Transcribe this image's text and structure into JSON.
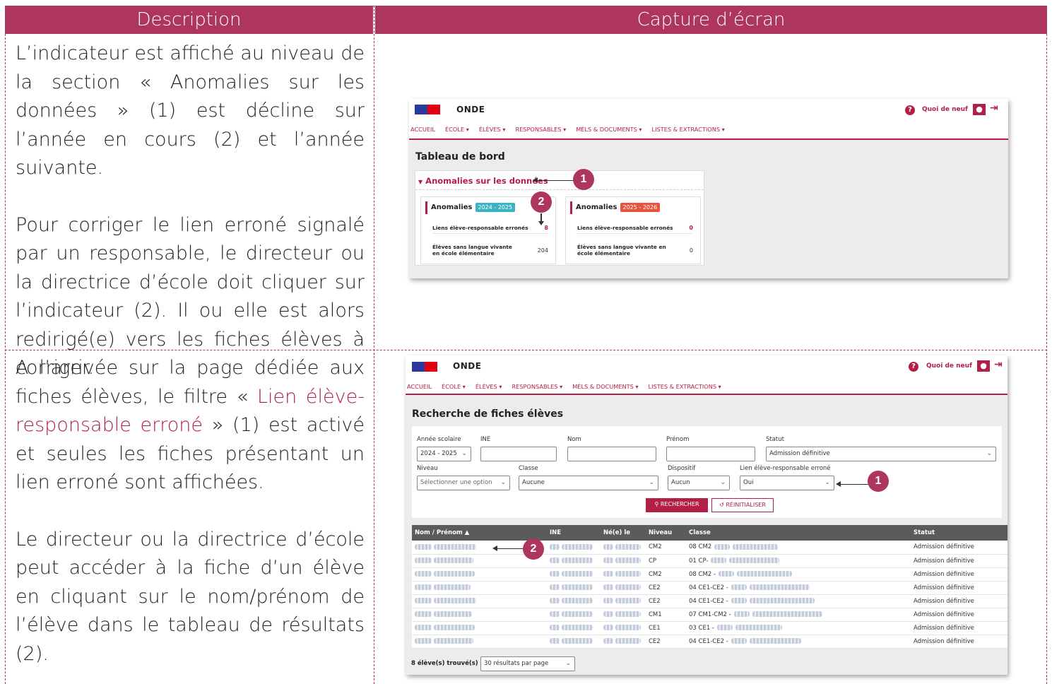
{
  "headers": {
    "description": "Description",
    "capture": "Capture d’écran"
  },
  "desc1": {
    "p1": "L’indicateur est affiché au niveau de la section « Anomalies sur les données » (1) est décline sur l’année en cours (2) et l’année suivante.",
    "p2": "Pour corriger le lien erroné signalé par un responsable, le directeur ou la directrice d’école doit cliquer sur l’indicateur (2). Il ou elle est alors redirigé(e) vers les fiches élèves à corriger."
  },
  "desc2": {
    "p1_a": "A l’arrivée sur la page dédiée aux fiches élèves, le filtre « ",
    "p1_hl": "Lien élève-responsable erroné",
    "p1_b": " » (1) est activé et seules les fiches présentant un lien erroné sont affichées.",
    "p2": "Le directeur ou la directrice d’école peut accéder à la fiche d’un élève en cliquant sur le nom/prénom de l’élève dans le tableau de résultats (2)."
  },
  "app": {
    "name": "ONDE",
    "help": "?",
    "whats_new": "Quoi de neuf",
    "menu": [
      "ACCUEIL",
      "ÉCOLE ▾",
      "ÉLÈVES ▾",
      "RESPONSABLES ▾",
      "MÉLS & DOCUMENTS ▾",
      "LISTES & EXTRACTIONS ▾"
    ]
  },
  "shot1": {
    "page_title": "Tableau de bord",
    "section": "Anomalies sur les données",
    "callout1": "1",
    "callout2": "2",
    "card1": {
      "title": "Anomalies",
      "year": "2024 - 2025",
      "rows": [
        {
          "label": "Liens élève-responsable erronés",
          "value": "8"
        },
        {
          "label": "Élèves sans langue vivante en école élémentaire",
          "value": "204"
        }
      ]
    },
    "card2": {
      "title": "Anomalies",
      "year": "2025 - 2026",
      "rows": [
        {
          "label": "Liens élève-responsable erronés",
          "value": "0"
        },
        {
          "label": "Élèves sans langue vivante en école élémentaire",
          "value": "0"
        }
      ]
    },
    "colors": {
      "year1": "#3bb3c3",
      "year2": "#e8533d"
    }
  },
  "shot2": {
    "page_title": "Recherche de fiches élèves",
    "callout1": "1",
    "callout2": "2",
    "fields": {
      "annee_label": "Année scolaire",
      "annee_value": "2024 - 2025",
      "ine_label": "INE",
      "nom_label": "Nom",
      "prenom_label": "Prénom",
      "statut_label": "Statut",
      "statut_value": "Admission définitive",
      "niveau_label": "Niveau",
      "niveau_value": "Sélectionner une option",
      "classe_label": "Classe",
      "classe_value": "Aucune",
      "dispositif_label": "Dispositif",
      "dispositif_value": "Aucun",
      "lien_label": "Lien élève-responsable erroné",
      "lien_value": "Oui"
    },
    "search_btn": "RECHERCHER",
    "reset_btn": "RÉINITIALISER",
    "columns": [
      "Nom / Prénom ▲",
      "INE",
      "Né(e) le",
      "Niveau",
      "Classe",
      "Statut"
    ],
    "rows": [
      {
        "niveau": "CM2",
        "classe": "08 CM2",
        "statut": "Admission définitive"
      },
      {
        "niveau": "CP",
        "classe": "01 CP-",
        "statut": "Admission définitive"
      },
      {
        "niveau": "CM2",
        "classe": "08 CM2 -",
        "statut": "Admission définitive"
      },
      {
        "niveau": "CE2",
        "classe": "04 CE1-CE2 -",
        "statut": "Admission définitive"
      },
      {
        "niveau": "CE2",
        "classe": "04 CE1-CE2 -",
        "statut": "Admission définitive"
      },
      {
        "niveau": "CM1",
        "classe": "07 CM1-CM2 -",
        "statut": "Admission définitive"
      },
      {
        "niveau": "CE1",
        "classe": "03 CE1 -",
        "statut": "Admission définitive"
      },
      {
        "niveau": "CE2",
        "classe": "04 CE1-CE2 -",
        "statut": "Admission définitive"
      }
    ],
    "found": "8 élève(s) trouvé(s)",
    "per_page": "30 résultats par page"
  }
}
